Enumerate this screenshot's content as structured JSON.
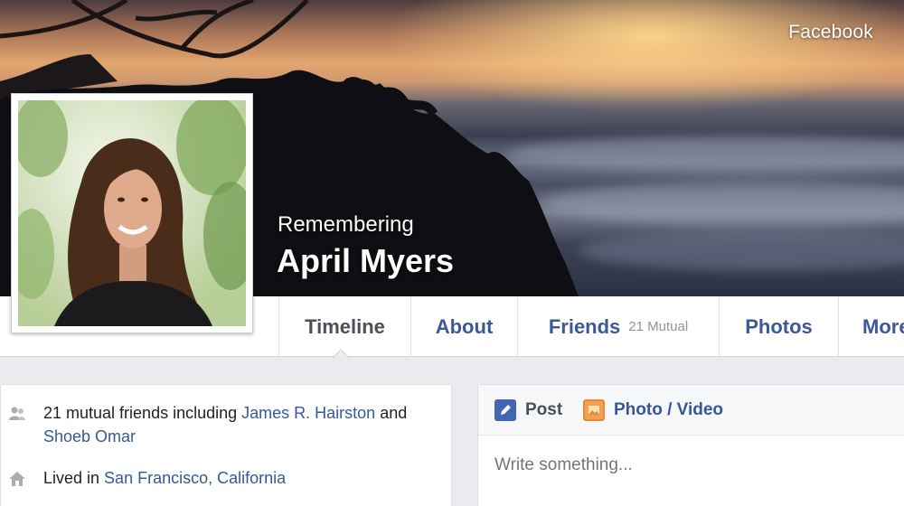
{
  "watermark": "Facebook",
  "profile": {
    "memorial_label": "Remembering",
    "name": "April Myers"
  },
  "nav": {
    "tabs": [
      {
        "label": "Timeline",
        "active": true
      },
      {
        "label": "About"
      },
      {
        "label": "Friends",
        "meta": "21 Mutual"
      },
      {
        "label": "Photos"
      },
      {
        "label": "More"
      }
    ]
  },
  "intro": {
    "mutual": {
      "prefix": "21 mutual friends including ",
      "friend1": "James R. Hairston",
      "joiner": " and ",
      "friend2": "Shoeb Omar"
    },
    "lived": {
      "prefix": "Lived in ",
      "place": "San Francisco, California"
    }
  },
  "composer": {
    "post_label": "Post",
    "photo_label": "Photo / Video",
    "placeholder": "Write something..."
  },
  "colors": {
    "link": "#365899",
    "nav_link": "#3b5998",
    "background": "#e9ebee"
  },
  "icons": {
    "friends": "friends-icon",
    "home": "home-icon",
    "post": "pencil-icon",
    "photo": "photo-icon"
  }
}
